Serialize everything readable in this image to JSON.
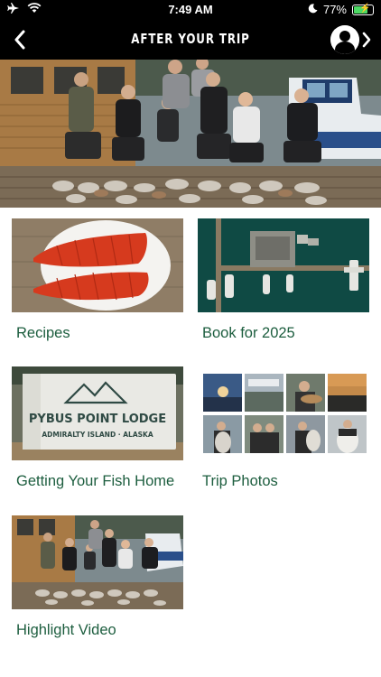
{
  "status": {
    "time": "7:49 AM",
    "battery": "77%",
    "battery_level": 0.77
  },
  "nav": {
    "title": "AFTER YOUR TRIP"
  },
  "tiles": [
    {
      "label": "Recipes"
    },
    {
      "label": "Book for 2025"
    },
    {
      "label": "Getting Your Fish Home"
    },
    {
      "label": "Trip Photos"
    },
    {
      "label": "Highlight Video"
    }
  ],
  "lodge_box": {
    "name": "PYBUS POINT LODGE",
    "location": "ADMIRALTY ISLAND · ALASKA"
  },
  "icons": {
    "airplane": "airplane-icon",
    "wifi": "wifi-icon",
    "moon": "moon-icon",
    "battery": "battery-charging-icon",
    "back": "chevron-left-icon",
    "profile": "user-avatar-icon",
    "forward": "chevron-right-icon"
  },
  "colors": {
    "label_green": "#1d5e3f",
    "nav_bg": "#000000",
    "battery_fill": "#4cd964"
  }
}
